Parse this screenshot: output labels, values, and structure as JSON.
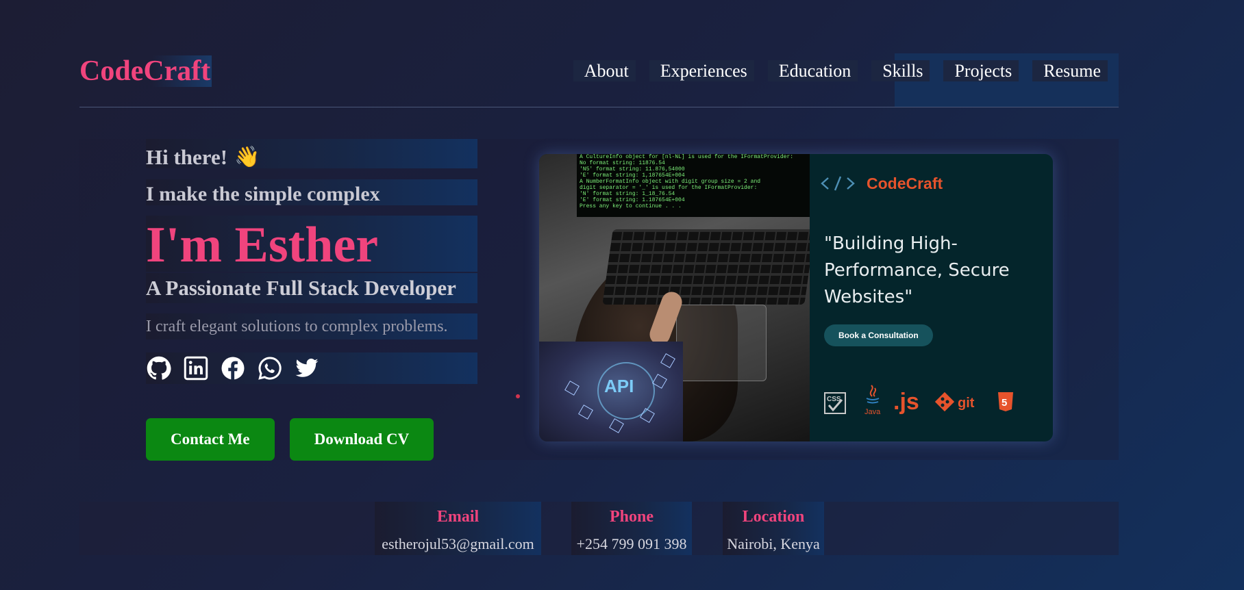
{
  "header": {
    "logo": "CodeCraft",
    "nav": [
      "About",
      "Experiences",
      "Education",
      "Skills",
      "Projects",
      "Resume"
    ]
  },
  "hero": {
    "greeting": "Hi there!",
    "greeting_emoji": "👋",
    "tagline": "I make the simple complex",
    "name": "I'm Esther",
    "role": "A Passionate Full Stack Developer",
    "description": "I craft elegant solutions to complex problems.",
    "socials": [
      "github-icon",
      "linkedin-icon",
      "facebook-icon",
      "whatsapp-icon",
      "twitter-icon"
    ],
    "buttons": {
      "contact": "Contact Me",
      "download": "Download CV"
    }
  },
  "banner": {
    "brand": "CodeCraft",
    "brand_icon_text": "</>",
    "quote": "\"Building High-\nPerformance, Secure\nWebsites\"",
    "cta": "Book a Consultation",
    "api_label": "API",
    "tech_labels": {
      "css": "CSS",
      "java": "Java",
      "js": ".js",
      "git": "git",
      "html5": "5"
    },
    "screen_lines": [
      "A CultureInfo object for [nl-NL] is used for the IFormatProvider:",
      "  No format string:            11876.54",
      "  'N5' format string:          11.876,54000",
      "  'E' format string:           1,187654E+004",
      "",
      "A NumberFormatInfo object with digit group size = 2 and",
      "digit separator = '_' is used for the IFormatProvider:",
      "  'N' format string:           1_18_76.54",
      "  'E' format string:           1.187654E+004",
      "Press any key to continue . . ."
    ]
  },
  "contact": {
    "email": {
      "label": "Email",
      "value": "estherojul53@gmail.com"
    },
    "phone": {
      "label": "Phone",
      "value": "+254 799 091 398"
    },
    "location": {
      "label": "Location",
      "value": "Nairobi, Kenya"
    }
  },
  "colors": {
    "accent_pink": "#f0447d",
    "button_green": "#0b8812",
    "banner_bg": "#04252b",
    "brand_orange": "#e6532c"
  }
}
